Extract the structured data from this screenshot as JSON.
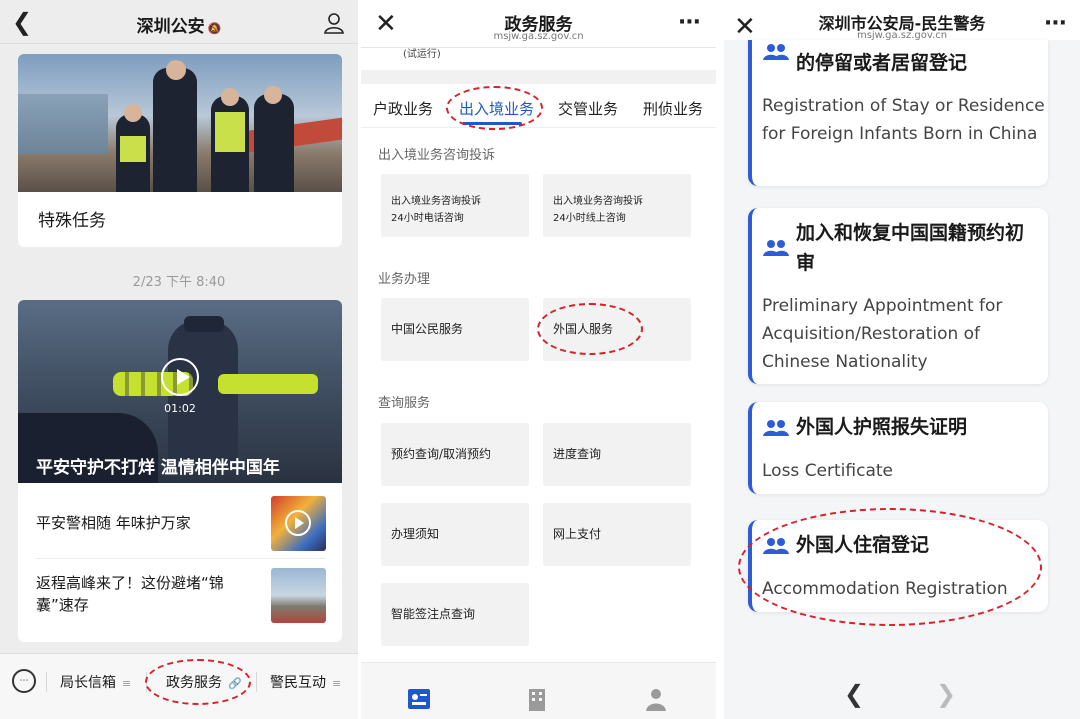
{
  "panel1": {
    "title": "深圳公安",
    "mute_icon": "bell-slash-icon",
    "card1_caption": "特殊任务",
    "timestamp": "2/23 下午 8:40",
    "video_duration": "01:02",
    "video_title": "平安守护不打烊 温情相伴中国年",
    "article1": "平安警相随 年味护万家",
    "article2": "返程高峰来了！这份避堵“锦囊”速存",
    "tabbar": [
      "局长信箱",
      "政务服务",
      "警民互动"
    ]
  },
  "panel2": {
    "title": "政务服务",
    "url": "msjw.ga.sz.gov.cn",
    "trial": "(试运行)",
    "tabs": [
      "户政业务",
      "出入境业务",
      "交管业务",
      "刑侦业务"
    ],
    "active_tab": "出入境业务",
    "sections": [
      {
        "title": "出入境业务咨询投诉",
        "tiles": [
          {
            "line1": "出入境业务咨询投诉",
            "line2": "24小时电话咨询"
          },
          {
            "line1": "出入境业务咨询投诉",
            "line2": "24小时线上咨询"
          }
        ]
      },
      {
        "title": "业务办理",
        "tiles": [
          "中国公民服务",
          "外国人服务"
        ]
      },
      {
        "title": "查询服务",
        "tiles": [
          "预约查询/取消预约",
          "进度查询",
          "办理须知",
          "网上支付",
          "智能签注点查询"
        ]
      }
    ]
  },
  "panel3": {
    "title": "深圳市公安局-民生警务",
    "url": "msjw.ga.sz.gov.cn",
    "accent": "#2e5bd6",
    "cards": [
      {
        "zh": "的停留或者居留登记",
        "en": "Registration of Stay or Residence for Foreign Infants Born in China"
      },
      {
        "zh": "加入和恢复中国国籍预约初审",
        "en": "Preliminary Appointment for Acquisition/Restoration of Chinese Nationality"
      },
      {
        "zh": "外国人护照报失证明",
        "en": "Loss Certificate"
      },
      {
        "zh": "外国人住宿登记",
        "en": "Accommodation Registration"
      }
    ]
  },
  "annotation_color": "#d8212a"
}
